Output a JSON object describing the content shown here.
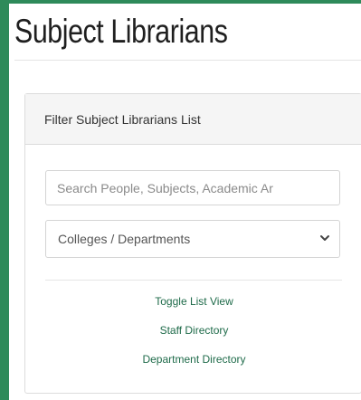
{
  "page": {
    "title": "Subject Librarians"
  },
  "filter_panel": {
    "heading": "Filter Subject Librarians List",
    "search": {
      "placeholder": "Search People, Subjects, Academic Ar",
      "value": ""
    },
    "department_select": {
      "selected": "Colleges / Departments",
      "icon": "chevron-down-icon"
    },
    "links": {
      "toggle_view": "Toggle List View",
      "staff_directory": "Staff Directory",
      "department_directory": "Department Directory"
    }
  },
  "colors": {
    "background_accent": "#2e8a5a",
    "link": "#1f6b4a"
  }
}
